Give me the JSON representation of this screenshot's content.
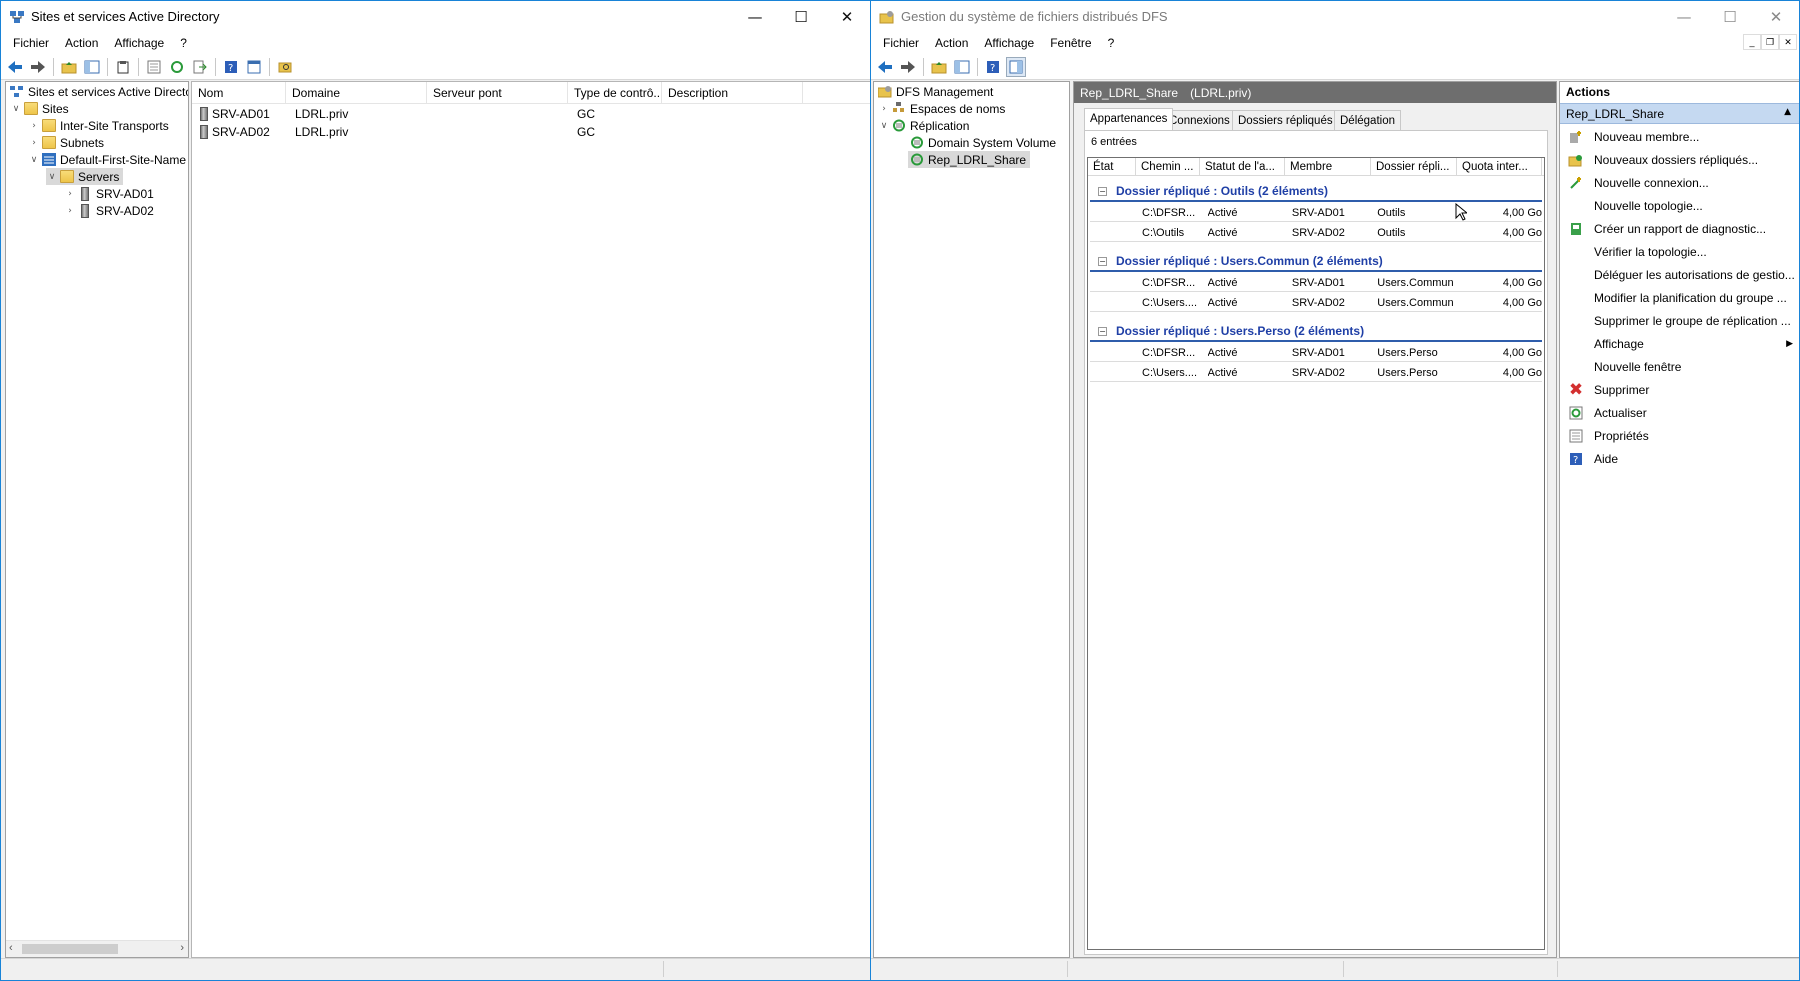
{
  "colors": {
    "accent": "#1883d7",
    "group_header": "#1f3fa6",
    "action_header": "#c5d9f1",
    "remove": "#d32f2f"
  },
  "ad_window": {
    "title": "Sites et services Active Directory",
    "menu": [
      "Fichier",
      "Action",
      "Affichage",
      "?"
    ],
    "tree": {
      "root": "Sites et services Active Directory",
      "sites": "Sites",
      "inter_site": "Inter-Site Transports",
      "subnets": "Subnets",
      "default_site": "Default-First-Site-Name",
      "servers": "Servers",
      "srv1": "SRV-AD01",
      "srv2": "SRV-AD02"
    },
    "list": {
      "columns": [
        "Nom",
        "Domaine",
        "Serveur pont",
        "Type de contrô...",
        "Description"
      ],
      "rows": [
        {
          "nom": "SRV-AD01",
          "domaine": "LDRL.priv",
          "pont": "",
          "type": "GC",
          "desc": ""
        },
        {
          "nom": "SRV-AD02",
          "domaine": "LDRL.priv",
          "pont": "",
          "type": "GC",
          "desc": ""
        }
      ]
    }
  },
  "dfs_window": {
    "title": "Gestion du système de fichiers distribués DFS",
    "menu": [
      "Fichier",
      "Action",
      "Affichage",
      "Fenêtre",
      "?"
    ],
    "tree": {
      "root": "DFS Management",
      "namespaces": "Espaces de noms",
      "replication": "Réplication",
      "dsv": "Domain System Volume",
      "share": "Rep_LDRL_Share"
    },
    "header": {
      "name": "Rep_LDRL_Share",
      "domain": "(LDRL.priv)"
    },
    "tabs": [
      "Appartenances",
      "Connexions",
      "Dossiers répliqués",
      "Délégation"
    ],
    "entries": "6 entrées",
    "columns": [
      "État",
      "Chemin ...",
      "Statut de l'a...",
      "Membre",
      "Dossier répli...",
      "Quota inter..."
    ],
    "groups": [
      {
        "title": "Dossier répliqué : Outils (2 éléments)",
        "rows": [
          {
            "chemin": "C:\\DFSR...",
            "statut": "Activé",
            "membre": "SRV-AD01",
            "dossier": "Outils",
            "quota": "4,00 Go"
          },
          {
            "chemin": "C:\\Outils",
            "statut": "Activé",
            "membre": "SRV-AD02",
            "dossier": "Outils",
            "quota": "4,00 Go"
          }
        ]
      },
      {
        "title": "Dossier répliqué : Users.Commun (2 éléments)",
        "rows": [
          {
            "chemin": "C:\\DFSR...",
            "statut": "Activé",
            "membre": "SRV-AD01",
            "dossier": "Users.Commun",
            "quota": "4,00 Go"
          },
          {
            "chemin": "C:\\Users....",
            "statut": "Activé",
            "membre": "SRV-AD02",
            "dossier": "Users.Commun",
            "quota": "4,00 Go"
          }
        ]
      },
      {
        "title": "Dossier répliqué : Users.Perso (2 éléments)",
        "rows": [
          {
            "chemin": "C:\\DFSR...",
            "statut": "Activé",
            "membre": "SRV-AD01",
            "dossier": "Users.Perso",
            "quota": "4,00 Go"
          },
          {
            "chemin": "C:\\Users....",
            "statut": "Activé",
            "membre": "SRV-AD02",
            "dossier": "Users.Perso",
            "quota": "4,00 Go"
          }
        ]
      }
    ],
    "actions": {
      "title": "Actions",
      "section": "Rep_LDRL_Share",
      "items": [
        {
          "label": "Nouveau membre...",
          "icon": "new-member-icon"
        },
        {
          "label": "Nouveaux dossiers répliqués...",
          "icon": "new-folders-icon"
        },
        {
          "label": "Nouvelle connexion...",
          "icon": "new-connection-icon"
        },
        {
          "label": "Nouvelle topologie...",
          "icon": ""
        },
        {
          "label": "Créer un rapport de diagnostic...",
          "icon": "report-icon"
        },
        {
          "label": "Vérifier la topologie...",
          "icon": ""
        },
        {
          "label": "Déléguer les autorisations de gestio...",
          "icon": ""
        },
        {
          "label": "Modifier la planification du groupe ...",
          "icon": ""
        },
        {
          "label": "Supprimer le groupe de réplication ...",
          "icon": ""
        },
        {
          "label": "Affichage",
          "icon": ""
        },
        {
          "label": "Nouvelle fenêtre",
          "icon": ""
        },
        {
          "label": "Supprimer",
          "icon": "delete-icon"
        },
        {
          "label": "Actualiser",
          "icon": "refresh-icon"
        },
        {
          "label": "Propriétés",
          "icon": "properties-icon"
        },
        {
          "label": "Aide",
          "icon": "help-icon"
        }
      ]
    }
  }
}
